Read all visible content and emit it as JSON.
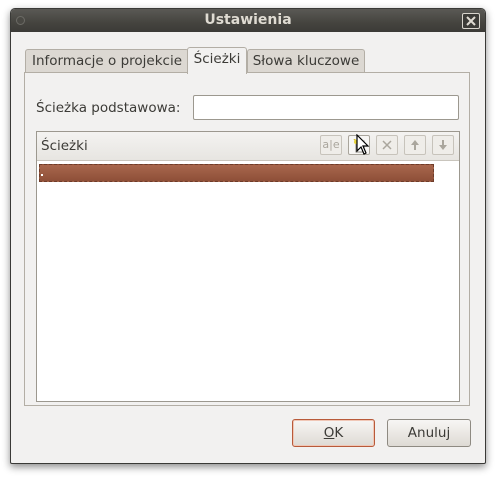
{
  "window": {
    "title": "Ustawienia"
  },
  "tabs": [
    {
      "label": "Informacje o projekcie",
      "active": false
    },
    {
      "label": "Ścieżki",
      "active": true
    },
    {
      "label": "Słowa kluczowe",
      "active": false
    }
  ],
  "base_path": {
    "label": "Ścieżka podstawowa:",
    "value": ""
  },
  "paths_list": {
    "header": "Ścieżki",
    "toolbar": {
      "rename_icon_text": "a|e",
      "icons": [
        "rename-icon",
        "new-path-icon",
        "delete-icon",
        "move-up-icon",
        "move-down-icon"
      ]
    },
    "rows": [
      {
        "text": ""
      }
    ],
    "selection_color": "#97573f"
  },
  "buttons": {
    "ok_mnemonic": "O",
    "ok_rest": "K",
    "cancel": "Anuluj"
  }
}
